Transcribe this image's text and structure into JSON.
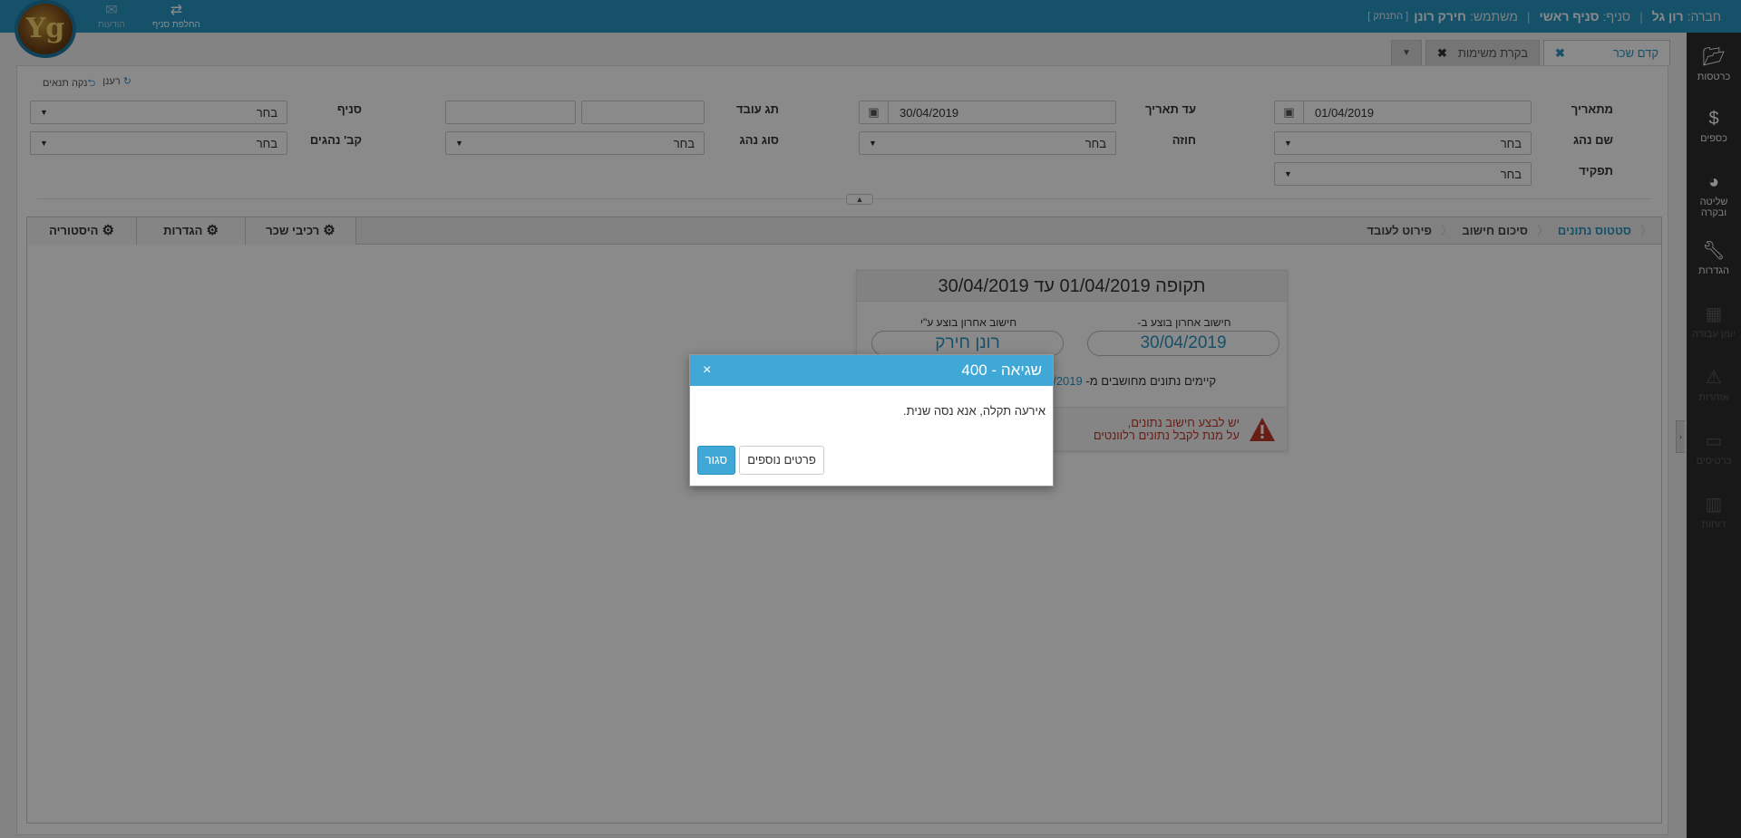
{
  "topbar": {
    "company_label": "חברה:",
    "company": "רון גל",
    "branch_label": "סניף:",
    "branch": "סניף ראשי",
    "user_label": "משתמש:",
    "user": "חירק רונן",
    "disconnect": "[ התנתק ]",
    "switch_branch": "החלפת סניף",
    "messages": "הודעות",
    "logo_text": "Yg"
  },
  "sidebar": {
    "items": [
      {
        "label": "כרטסות",
        "icon": "folder-icon"
      },
      {
        "label": "כספים",
        "icon": "dollar-icon"
      },
      {
        "label": "שליטה ובקרה",
        "icon": "dashboard-icon"
      },
      {
        "label": "הגדרות",
        "icon": "wrench-icon"
      },
      {
        "label": "יומן עבודה",
        "icon": "calendar-icon"
      },
      {
        "label": "אזהרות",
        "icon": "alert-icon"
      },
      {
        "label": "כרטיסים",
        "icon": "card-icon"
      },
      {
        "label": "דוחות",
        "icon": "chart-icon"
      }
    ]
  },
  "tabs": [
    {
      "label": "קדם שכר",
      "close": "✖"
    },
    {
      "label": "בקרת משימות",
      "close": "✖"
    }
  ],
  "toolbar": {
    "refresh": "רענן",
    "clear_conditions": "נקה תנאים"
  },
  "filters": {
    "from_date_label": "מתאריך",
    "from_date": "01/04/2019",
    "to_date_label": "עד תאריך",
    "to_date": "30/04/2019",
    "employee_tag_label": "תג עובד",
    "branch_label": "סניף",
    "driver_name_label": "שם נהג",
    "contract_label": "חוזה",
    "driver_type_label": "סוג נהג",
    "driver_group_label": "קב' נהגים",
    "role_label": "תפקיד",
    "choose": "בחר"
  },
  "section_tabs": {
    "data_status": "סטטוס נתונים",
    "calc_summary": "סיכום חישוב",
    "employee_detail": "פירוט לעובד",
    "pay_components": "רכיבי שכר",
    "settings": "הגדרות",
    "history": "היסטוריה"
  },
  "card": {
    "title": "תקופה 01/04/2019 עד 30/04/2019",
    "last_calc_at_label": "חישוב אחרון בוצע ב-",
    "last_calc_at": "30/04/2019",
    "last_calc_by_label": "חישוב אחרון בוצע ע\"י",
    "last_calc_by": "רונן חירק",
    "exists_text": "קיימים נתונים מחושבים מ-",
    "exists_date": "01/04/2019",
    "warning_line1": "יש לבצע חישוב נתונים,",
    "warning_line2": "על מנת לקבל נתונים רלוונטים"
  },
  "modal": {
    "title": "שגיאה - 400",
    "close_x": "×",
    "message": "אירעה תקלה, אנא נסה שנית.",
    "close_button": "סגור",
    "details_button": "פרטים נוספים"
  },
  "colors": {
    "primary": "#2a96c4",
    "modal_header": "#3fa8d6",
    "sidebar": "#2e2e2e",
    "warning": "#c0392b"
  }
}
